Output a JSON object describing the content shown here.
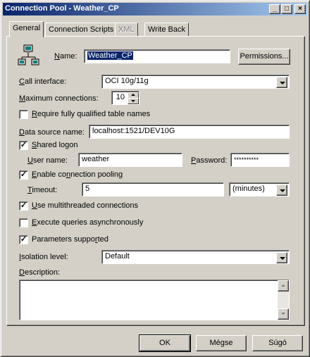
{
  "window": {
    "title": "Connection Pool - Weather_CP",
    "minimize": "_",
    "maximize": "□",
    "close": "×"
  },
  "tabs": [
    {
      "label": "General",
      "state": "active"
    },
    {
      "label": "Connection Scripts",
      "state": "normal"
    },
    {
      "label": "XML",
      "state": "disabled"
    },
    {
      "label": "Write Back",
      "state": "normal"
    }
  ],
  "form": {
    "name_label": "Name:",
    "name_value": "Weather_CP",
    "permissions_button": "Permissions...",
    "call_interface_label": "Call interface:",
    "call_interface_value": "OCI 10g/11g",
    "max_connections_label": "Maximum connections:",
    "max_connections_value": "10",
    "require_qualified_label": "Require fully qualified table names",
    "require_qualified_checked": false,
    "data_source_label": "Data source name:",
    "data_source_value": "localhost:1521/DEV10G",
    "shared_logon_label": "Shared logon",
    "shared_logon_checked": true,
    "user_name_label": "User name:",
    "user_name_value": "weather",
    "password_label": "Password:",
    "password_value": "**********",
    "enable_pooling_label": "Enable connection pooling",
    "enable_pooling_checked": true,
    "timeout_label": "Timeout:",
    "timeout_value": "5",
    "timeout_unit": "(minutes)",
    "multithreaded_label": "Use multithreaded connections",
    "multithreaded_checked": true,
    "async_label": "Execute queries asynchronously",
    "async_checked": false,
    "params_label": "Parameters supported",
    "params_checked": true,
    "isolation_label": "Isolation level:",
    "isolation_value": "Default",
    "description_label": "Description:",
    "description_value": ""
  },
  "footer": {
    "ok": "OK",
    "cancel": "Mégse",
    "help": "Súgó"
  },
  "check_mark": "✓"
}
